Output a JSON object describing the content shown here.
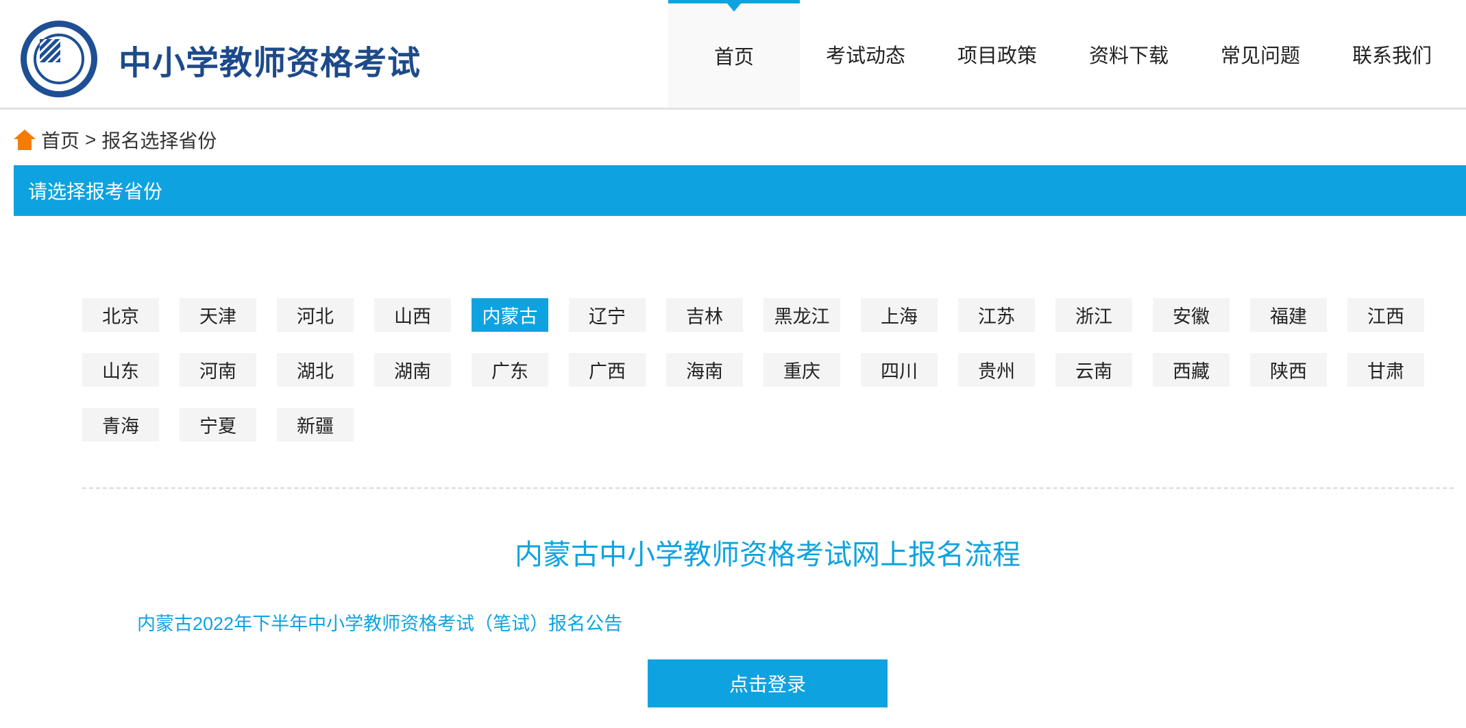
{
  "header": {
    "logo_text": "中小学教师资格考试",
    "nav": [
      "首页",
      "考试动态",
      "项目政策",
      "资料下载",
      "常见问题",
      "联系我们"
    ],
    "active_nav": 0
  },
  "breadcrumb": {
    "home": "首页",
    "separator": ">",
    "current": "报名选择省份"
  },
  "section_title": "请选择报考省份",
  "provinces": [
    "北京",
    "天津",
    "河北",
    "山西",
    "内蒙古",
    "辽宁",
    "吉林",
    "黑龙江",
    "上海",
    "江苏",
    "浙江",
    "安徽",
    "福建",
    "江西",
    "山东",
    "河南",
    "湖北",
    "湖南",
    "广东",
    "广西",
    "海南",
    "重庆",
    "四川",
    "贵州",
    "云南",
    "西藏",
    "陕西",
    "甘肃",
    "青海",
    "宁夏",
    "新疆"
  ],
  "selected_province": "内蒙古",
  "process_title": "内蒙古中小学教师资格考试网上报名流程",
  "notice_link": "内蒙古2022年下半年中小学教师资格考试（笔试）报名公告",
  "login_button": "点击登录",
  "colors": {
    "accent": "#0ea3e0",
    "logo": "#1d4a8a",
    "home_icon": "#f57c00"
  }
}
